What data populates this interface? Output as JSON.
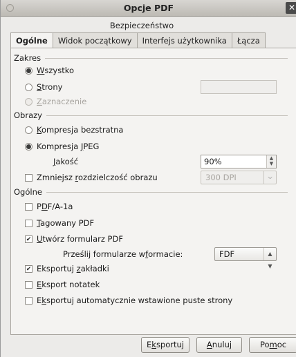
{
  "window": {
    "title": "Opcje PDF",
    "close_glyph": "✕"
  },
  "tabs": {
    "top_row": "Bezpieczeństwo",
    "items": [
      {
        "label": "Ogólne",
        "active": true
      },
      {
        "label": "Widok początkowy"
      },
      {
        "label": "Interfejs użytkownika"
      },
      {
        "label": "Łącza"
      }
    ]
  },
  "range": {
    "heading": "Zakres",
    "all": {
      "prefix": "",
      "key": "W",
      "rest": "szystko",
      "selected": true
    },
    "pages": {
      "prefix": "",
      "key": "S",
      "rest": "trony",
      "value": ""
    },
    "selection": {
      "prefix": "",
      "key": "Z",
      "rest": "aznaczenie",
      "disabled": true
    }
  },
  "images": {
    "heading": "Obrazy",
    "lossless": {
      "prefix": "",
      "key": "K",
      "rest": "ompresja bezstratna"
    },
    "jpeg": {
      "prefix": "Kompresja ",
      "key": "J",
      "rest": "PEG",
      "selected": true
    },
    "quality": {
      "prefix": "",
      "key": "J",
      "rest": "akość",
      "value": "90%"
    },
    "reduce": {
      "prefix": "Zmniejsz ",
      "key": "r",
      "rest": "ozdzielczość obrazu",
      "value": "300 DPI"
    }
  },
  "general": {
    "heading": "Ogólne",
    "pdfa": {
      "prefix": "P",
      "key": "D",
      "rest": "F/A-1a"
    },
    "tagged": {
      "prefix": "",
      "key": "T",
      "rest": "agowany PDF"
    },
    "forms": {
      "prefix": "",
      "key": "U",
      "rest": "twórz formularz PDF",
      "checked": true
    },
    "submit": {
      "prefix": "Prześlij formularze w ",
      "key": "f",
      "rest": "ormacie:",
      "value": "FDF"
    },
    "bookmarks": {
      "prefix": "Eksportuj ",
      "key": "z",
      "rest": "akładki",
      "checked": true
    },
    "notes": {
      "prefix": "",
      "key": "E",
      "rest": "ksport notatek"
    },
    "blank": {
      "prefix": "E",
      "key": "k",
      "rest": "sportuj automatycznie wstawione puste strony"
    }
  },
  "buttons": {
    "export": {
      "prefix": "E",
      "key": "k",
      "rest": "sportuj"
    },
    "cancel": {
      "prefix": "",
      "key": "A",
      "rest": "nuluj"
    },
    "help": {
      "prefix": "Po",
      "key": "m",
      "rest": "oc"
    }
  },
  "icons": {
    "spin": "spinner-arrows-icon",
    "dropdown": "chevron-down-icon",
    "check": "check-mark-icon"
  }
}
